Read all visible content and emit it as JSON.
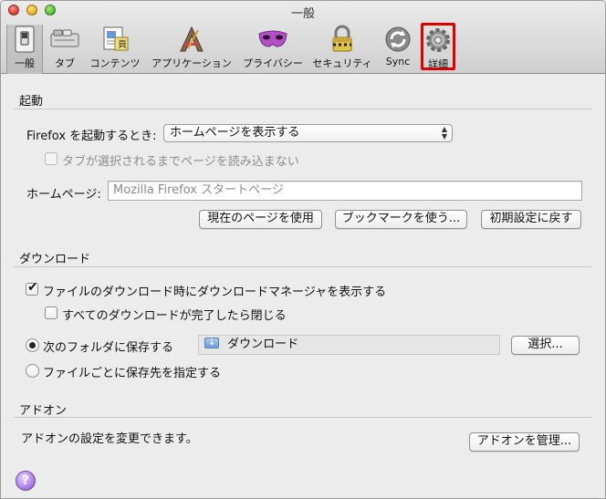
{
  "window": {
    "title": "一般"
  },
  "toolbar": {
    "items": [
      {
        "label": "一般",
        "icon": "general-switch-icon"
      },
      {
        "label": "タブ",
        "icon": "tabs-icon"
      },
      {
        "label": "コンテンツ",
        "icon": "content-icon"
      },
      {
        "label": "アプリケーション",
        "icon": "applications-icon"
      },
      {
        "label": "プライバシー",
        "icon": "privacy-mask-icon"
      },
      {
        "label": "セキュリティ",
        "icon": "security-lock-icon"
      },
      {
        "label": "Sync",
        "icon": "sync-icon"
      },
      {
        "label": "詳細",
        "icon": "advanced-gear-icon"
      }
    ],
    "selected": "一般",
    "highlight_color": "#e00000"
  },
  "startup": {
    "section_title": "起動",
    "when_start_label": "Firefox を起動するとき:",
    "when_start_value": "ホームページを表示する",
    "dont_load_tabs_label": "タブが選択されるまでページを読み込まない",
    "homepage_label": "ホームページ:",
    "homepage_placeholder": "Mozilla Firefox スタートページ",
    "btn_current": "現在のページを使用",
    "btn_bookmark": "ブックマークを使う...",
    "btn_restore": "初期設定に戻す"
  },
  "downloads": {
    "section_title": "ダウンロード",
    "show_manager_label": "ファイルのダウンロード時にダウンロードマネージャを表示する",
    "show_manager_checked": true,
    "close_when_done_label": "すべてのダウンロードが完了したら閉じる",
    "close_when_done_checked": false,
    "save_to_label": "次のフォルダに保存する",
    "save_to_selected": true,
    "folder_name": "ダウンロード",
    "choose_button": "選択...",
    "ask_label": "ファイルごとに保存先を指定する"
  },
  "addons": {
    "section_title": "アドオン",
    "description": "アドオンの設定を変更できます。",
    "manage_button": "アドオンを管理..."
  },
  "help": {
    "glyph": "?"
  }
}
